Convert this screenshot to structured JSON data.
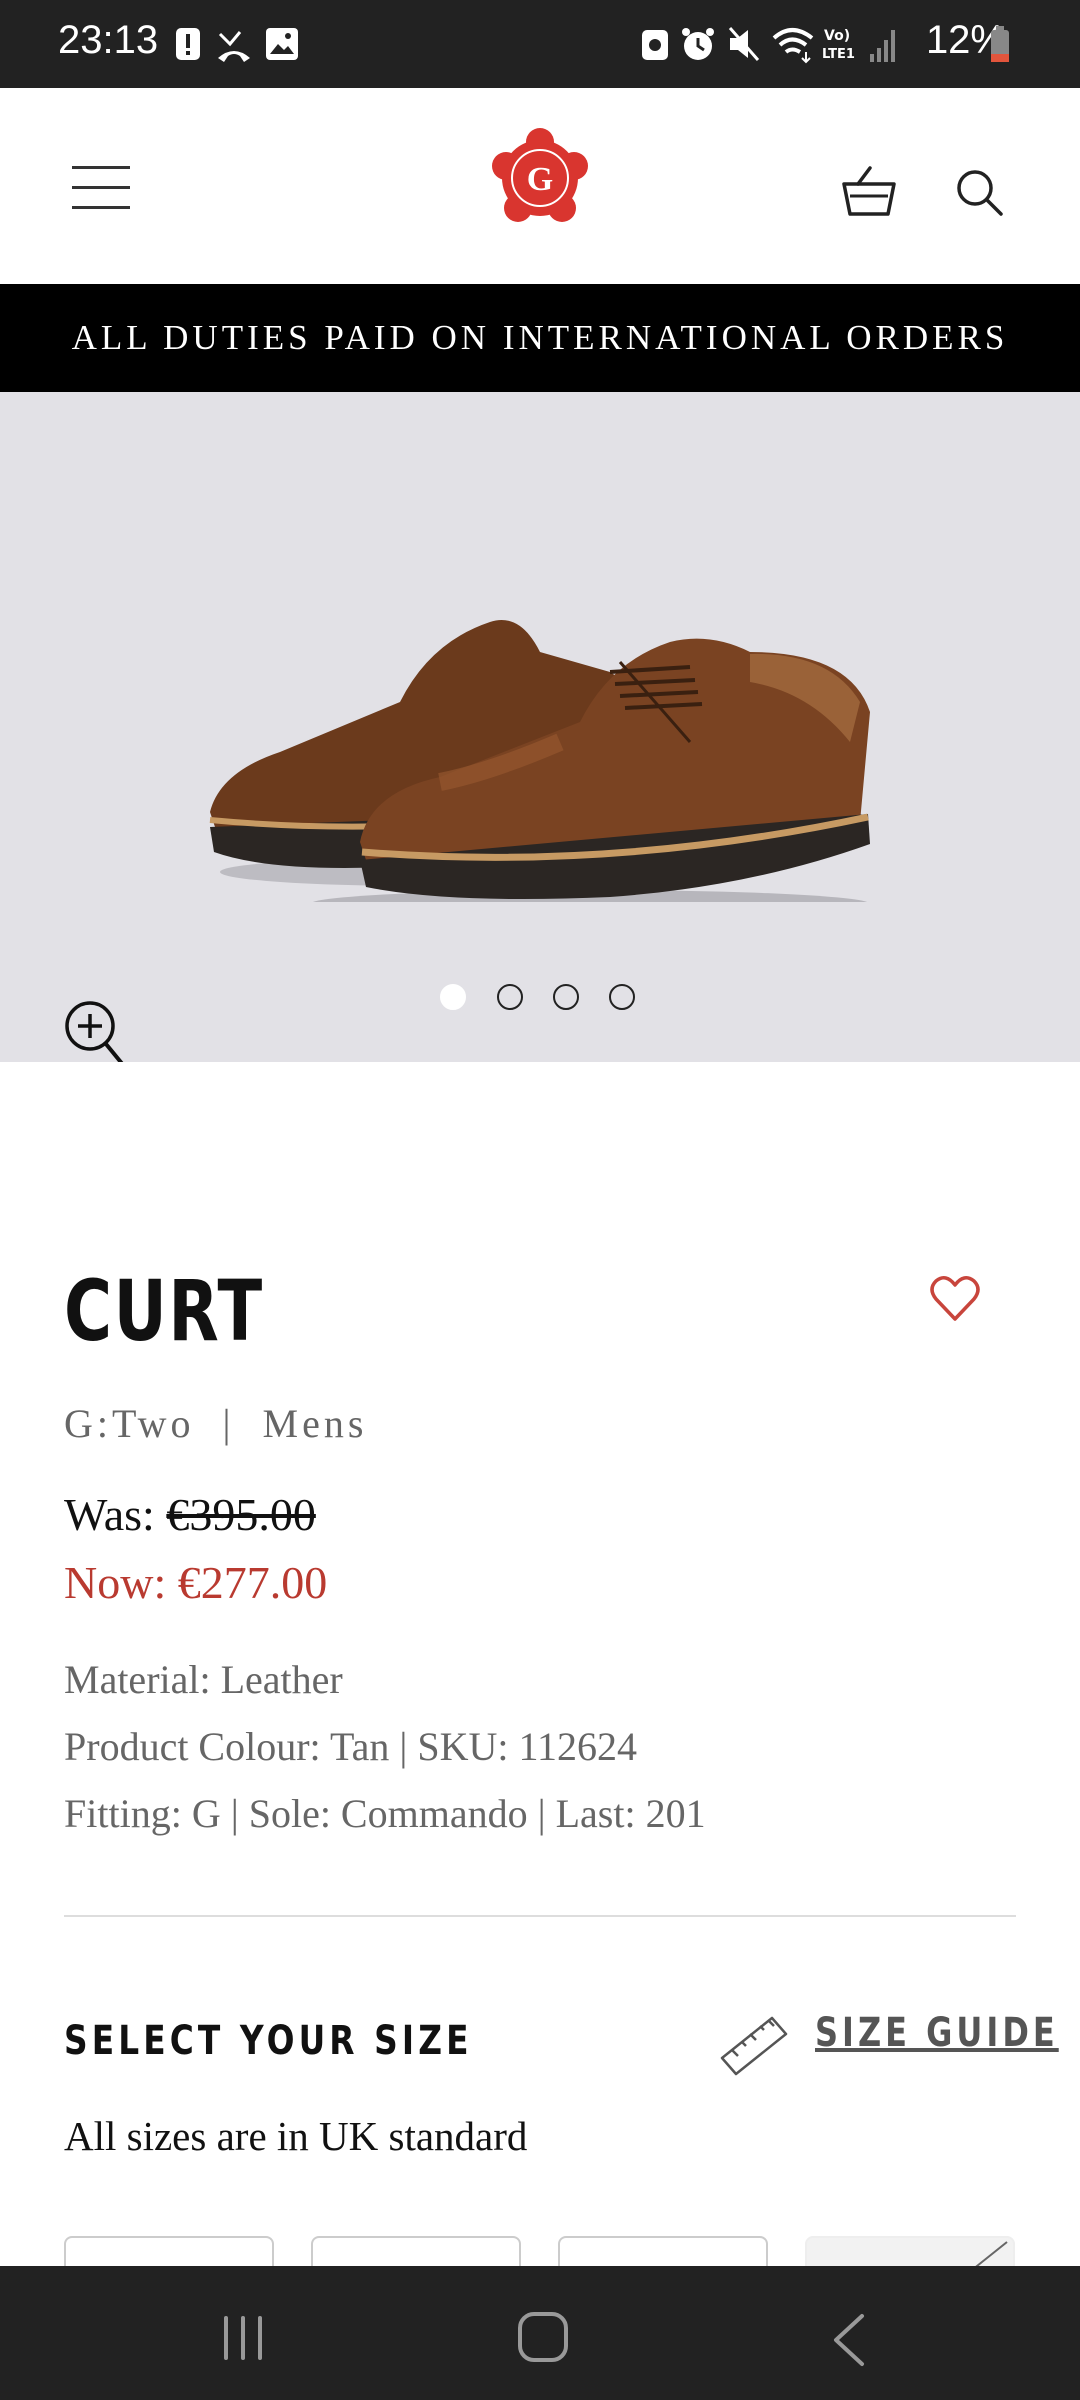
{
  "status_bar": {
    "time": "23:13",
    "battery": "12%",
    "icons": [
      "alert-icon",
      "missed-call-icon",
      "gallery-icon",
      "notification-icon",
      "alarm-icon",
      "mute-icon",
      "wifi-icon",
      "volte-icon",
      "signal-icon",
      "battery-icon"
    ]
  },
  "header": {
    "logo_letter": "G",
    "brand_color": "#d9352f"
  },
  "banner": {
    "text": "ALL DUTIES PAID ON INTERNATIONAL ORDERS"
  },
  "gallery": {
    "slide_count": 4,
    "active_slide": 1
  },
  "product": {
    "title": "CURT",
    "subtitle": "G:Two  |  Mens",
    "was_label": "Was:",
    "was_price": "€395.00",
    "now_price": "Now: €277.00",
    "material": "Material: Leather",
    "colour_sku": "Product Colour: Tan | SKU: 112624",
    "fitting": "Fitting: G | Sole: Commando | Last: 201",
    "sale_color": "#b93a30"
  },
  "size_section": {
    "title": "SELECT YOUR SIZE",
    "guide_label": "SIZE GUIDE",
    "note": "All sizes are in UK standard"
  }
}
